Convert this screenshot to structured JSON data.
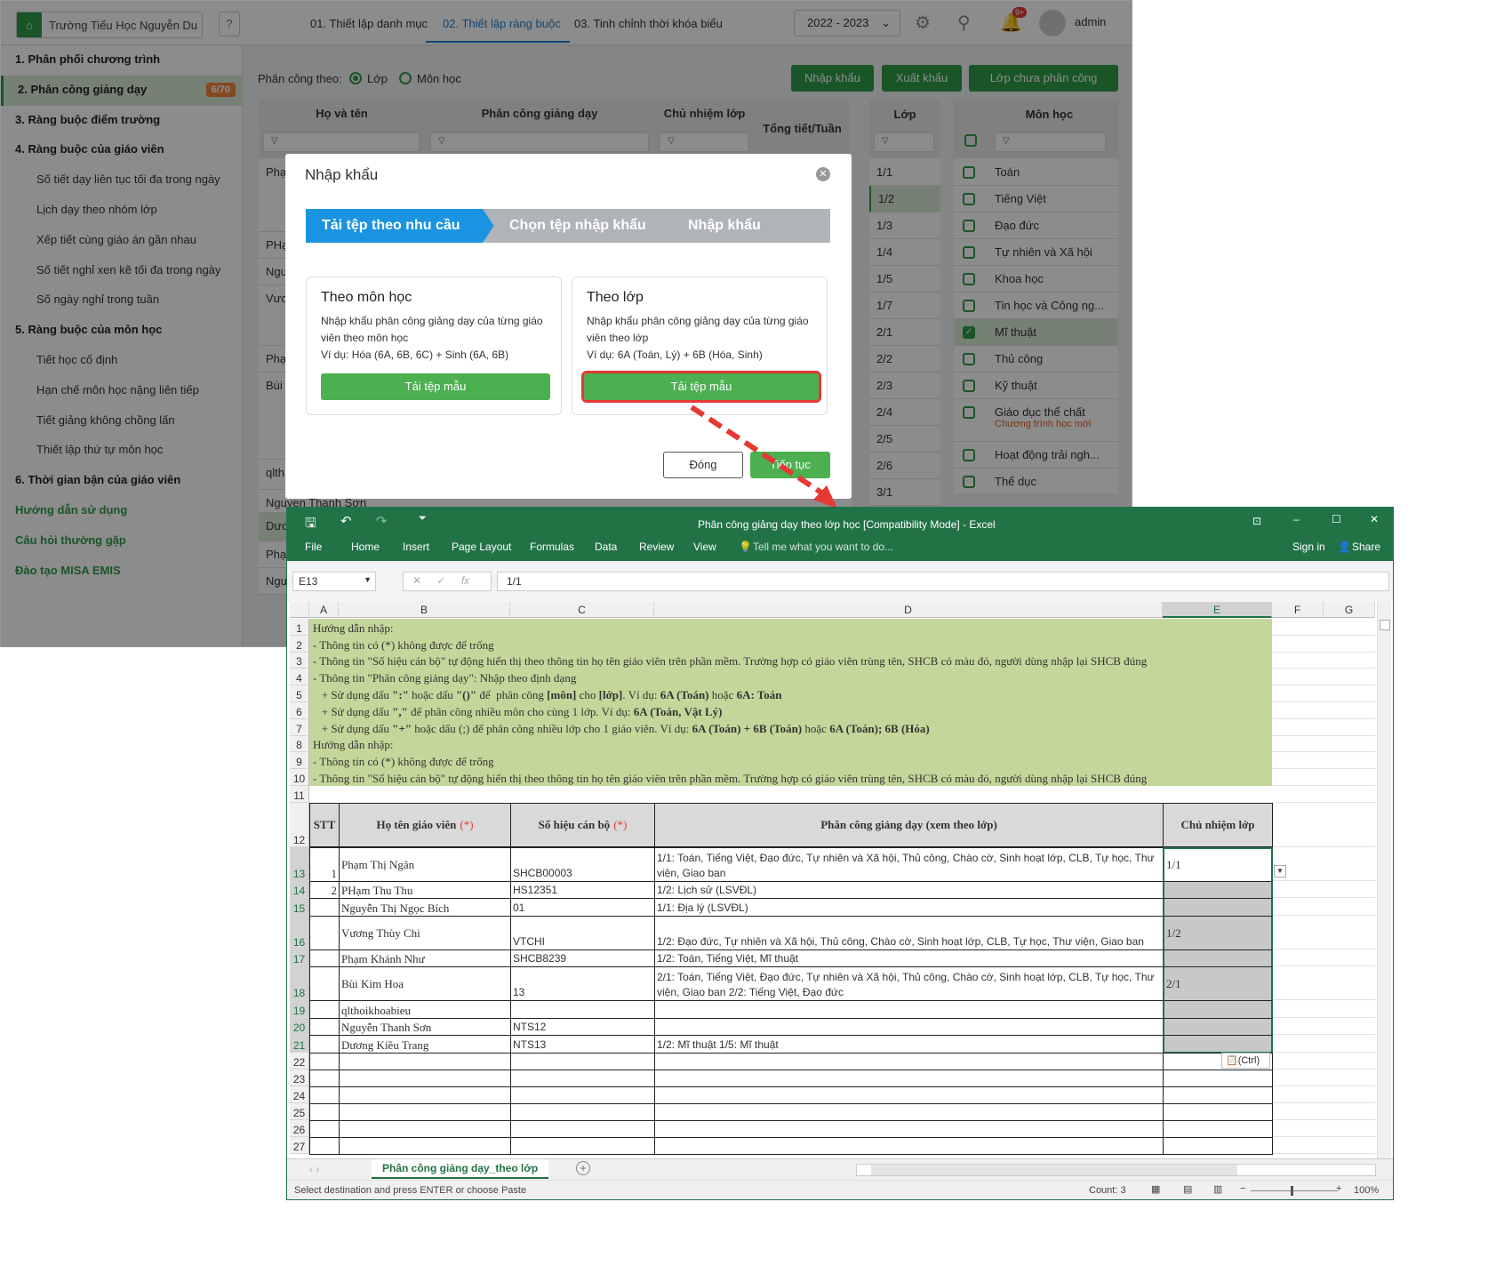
{
  "app": {
    "school": "Trường Tiểu Học Nguyễn Du",
    "nav_tabs": [
      "01. Thiết lập danh mục",
      "02. Thiết lập ràng buộc",
      "03. Tinh chỉnh thời khóa biểu"
    ],
    "year": "2022 - 2023",
    "notif_badge": "9+",
    "user": "admin",
    "sidebar": [
      {
        "label": "1. Phân phối chương trình",
        "type": "b"
      },
      {
        "label": "2. Phân công giảng dạy",
        "type": "b",
        "badge": "6/70"
      },
      {
        "label": "3. Ràng buộc điểm trường",
        "type": "b"
      },
      {
        "label": "4. Ràng buộc của giáo viên",
        "type": "b"
      },
      {
        "label": "Số tiết dạy liên tục tối đa trong ngày",
        "type": "sub"
      },
      {
        "label": "Lịch dạy theo nhóm lớp",
        "type": "sub"
      },
      {
        "label": "Xếp tiết cùng giáo án gần nhau",
        "type": "sub"
      },
      {
        "label": "Số tiết nghỉ xen kẽ tối đa trong ngày",
        "type": "sub"
      },
      {
        "label": "Số ngày nghỉ trong tuần",
        "type": "sub"
      },
      {
        "label": "5. Ràng buộc của môn học",
        "type": "b"
      },
      {
        "label": "Tiết học cố định",
        "type": "sub"
      },
      {
        "label": "Hạn chế môn học nặng liên tiếp",
        "type": "sub"
      },
      {
        "label": "Tiết giảng không chồng lấn",
        "type": "sub"
      },
      {
        "label": "Thiết lập thứ tự môn học",
        "type": "sub"
      },
      {
        "label": "6. Thời gian bận của giáo viên",
        "type": "b"
      },
      {
        "label": "Hướng dẫn sử dụng",
        "type": "g"
      },
      {
        "label": "Câu hỏi thường gặp",
        "type": "g"
      },
      {
        "label": "Đào tạo MISA EMIS",
        "type": "g"
      }
    ],
    "assign_by_label": "Phân công theo:",
    "assign_by_options": [
      "Lớp",
      "Môn học"
    ],
    "buttons": {
      "import": "Nhập khẩu",
      "export": "Xuất khẩu",
      "unassigned": "Lớp chưa phân công"
    },
    "table_headers": {
      "name": "Họ và tên",
      "assign": "Phân công giảng dạy",
      "homeroom": "Chủ nhiệm lớp",
      "total": "Tổng tiết/Tuần",
      "class": "Lớp",
      "subject": "Môn học"
    },
    "teacher_rows_visible": [
      "Phạ",
      "PHạ",
      "Ngu",
      "Vươ",
      "Phạ",
      "Bùi",
      "qlth",
      "Nguyen Thanh Sơn",
      "Dươ",
      "Phạ",
      "Ngu"
    ],
    "classes": [
      "1/1",
      "1/2",
      "1/3",
      "1/4",
      "1/5",
      "1/7",
      "2/1",
      "2/2",
      "2/3",
      "2/4",
      "2/5",
      "2/6",
      "3/1"
    ],
    "subjects": [
      {
        "name": "Toán",
        "checked": false
      },
      {
        "name": "Tiếng Việt",
        "checked": false
      },
      {
        "name": "Đạo đức",
        "checked": false
      },
      {
        "name": "Tự nhiên và Xã hội",
        "checked": false
      },
      {
        "name": "Khoa học",
        "checked": false
      },
      {
        "name": "Tin học và Công ng...",
        "checked": false
      },
      {
        "name": "Mĩ thuật",
        "checked": true
      },
      {
        "name": "Thủ công",
        "checked": false
      },
      {
        "name": "Kỹ thuật",
        "checked": false
      },
      {
        "name": "Giáo dục thể chất",
        "checked": false,
        "note": "Chương trình học mới"
      },
      {
        "name": "Hoạt động trải ngh...",
        "checked": false
      },
      {
        "name": "Thể dục",
        "checked": false
      }
    ]
  },
  "modal": {
    "title": "Nhập khẩu",
    "steps": [
      "Tải tệp theo nhu cầu",
      "Chọn tệp nhập khẩu",
      "Nhập khẩu"
    ],
    "cards": [
      {
        "title": "Theo môn học",
        "desc": "Nhập khẩu phân công giảng dạy của từng giáo viên theo môn học",
        "example": "Ví dụ: Hóa (6A, 6B, 6C) + Sinh (6A, 6B)",
        "button": "Tải tệp mẫu"
      },
      {
        "title": "Theo lớp",
        "desc": "Nhập khẩu phân công giảng dạy của từng giáo viên theo lớp",
        "example": "Ví dụ: 6A (Toán, Lý) + 6B (Hóa, Sinh)",
        "button": "Tải tệp mẫu"
      }
    ],
    "close_label": "Đóng",
    "continue_label": "Tiếp tục",
    "highlight_color": "#e53935"
  },
  "excel": {
    "title": "Phân công giảng dạy theo lớp học  [Compatibility Mode] - Excel",
    "ribbon_tabs": [
      "File",
      "Home",
      "Insert",
      "Page Layout",
      "Formulas",
      "Data",
      "Review",
      "View"
    ],
    "tell_me": "Tell me what you want to do...",
    "sign_in": "Sign in",
    "share": "Share",
    "name_box": "E13",
    "formula": "1/1",
    "columns": [
      "A",
      "B",
      "C",
      "D",
      "E",
      "F",
      "G"
    ],
    "guide_rows": [
      [
        {
          "t": "Hướng dẫn nhập:"
        }
      ],
      [
        {
          "t": "- Thông tin có (*) không được để trống"
        }
      ],
      [
        {
          "t": "- Thông tin \"Số hiệu cán bộ\" tự động hiển thị theo thông tin họ tên giáo viên trên phần mềm. Trường hợp có giáo viên trùng tên, SHCB có màu đỏ, người dùng nhập lại SHCB đúng"
        }
      ],
      [
        {
          "t": "- Thông tin \"Phân công giảng dạy\": Nhập theo định dạng"
        }
      ],
      [
        {
          "t": "   + Sử dụng dấu "
        },
        {
          "t": "\":\"",
          "b": true
        },
        {
          "t": " hoặc dấu "
        },
        {
          "t": "\"()\"",
          "b": true
        },
        {
          "t": " để  phân công "
        },
        {
          "t": "[môn]",
          "b": true
        },
        {
          "t": " cho "
        },
        {
          "t": "[lớp]",
          "b": true
        },
        {
          "t": ". Ví dụ: "
        },
        {
          "t": "6A (Toán)",
          "b": true
        },
        {
          "t": " hoặc "
        },
        {
          "t": "6A: Toán",
          "b": true
        }
      ],
      [
        {
          "t": "   + Sử dụng dấu "
        },
        {
          "t": "\",\"",
          "b": true
        },
        {
          "t": " để phân công nhiều môn cho cùng 1 lớp. Ví dụ: "
        },
        {
          "t": "6A (Toán, Vật Lý)",
          "b": true
        }
      ],
      [
        {
          "t": "   + Sử dụng dấu "
        },
        {
          "t": "\"+\"",
          "b": true
        },
        {
          "t": " hoặc dấu (;) để phân công nhiều lớp cho 1 giáo viên. Ví dụ: "
        },
        {
          "t": "6A (Toán) + 6B (Toán)",
          "b": true
        },
        {
          "t": " hoặc "
        },
        {
          "t": "6A (Toán); 6B (Hóa)",
          "b": true
        }
      ],
      [
        {
          "t": "Hướng dẫn nhập:"
        }
      ],
      [
        {
          "t": "- Thông tin có (*) không được để trống"
        }
      ],
      [
        {
          "t": "- Thông tin \"Số hiệu cán bộ\" tự động hiển thị theo thông tin họ tên giáo viên trên phần mềm. Trường hợp có giáo viên trùng tên, SHCB có màu đỏ, người dùng nhập lại SHCB đúng"
        }
      ]
    ],
    "table_header": {
      "stt": "STT",
      "name": "Họ tên giáo viên",
      "code": "Số hiệu cán bộ",
      "assign": "Phân công giảng dạy (xem theo lớp)",
      "homeroom": "Chủ nhiệm lớp",
      "required": "(*)"
    },
    "rows": [
      {
        "row": "13",
        "stt": "1",
        "name": "Phạm Thị Ngân",
        "code": "SHCB00003",
        "assign": "1/1: Toán, Tiếng Việt, Đạo đức, Tự nhiên và Xã hội, Thủ công, Chào cờ, Sinh hoạt lớp, CLB, Tự học, Thư viện, Giao ban",
        "homeroom": "1/1",
        "tall": true
      },
      {
        "row": "14",
        "stt": "2",
        "name": "PHạm Thu Thu",
        "code": "HS12351",
        "assign": "1/2: Lịch sử (LSVĐL)",
        "homeroom": ""
      },
      {
        "row": "15",
        "stt": "",
        "name": "Nguyễn Thị Ngọc Bích",
        "code": "01",
        "assign": "1/1: Địa lý (LSVĐL)",
        "homeroom": ""
      },
      {
        "row": "16",
        "stt": "",
        "name": "Vương Thùy Chi",
        "code": "VTCHI",
        "assign": "1/2: Đạo đức, Tự nhiên và Xã hội, Thủ công, Chào cờ, Sinh hoạt lớp, CLB, Tự học, Thư viện, Giao ban",
        "homeroom": "1/2",
        "tall": true
      },
      {
        "row": "17",
        "stt": "",
        "name": "Phạm Khánh Như",
        "code": "SHCB8239",
        "assign": "1/2: Toán, Tiếng Việt, Mĩ thuật",
        "homeroom": ""
      },
      {
        "row": "18",
        "stt": "",
        "name": "Bùi Kim Hoa",
        "code": "13",
        "assign": "2/1: Toán, Tiếng Việt, Đạo đức, Tự nhiên và Xã hội, Thủ công, Chào cờ, Sinh hoạt lớp, CLB, Tự học, Thư viện, Giao ban    2/2: Tiếng Việt, Đạo đức",
        "homeroom": "2/1",
        "tall": true
      },
      {
        "row": "19",
        "stt": "",
        "name": "qlthoikhoabieu",
        "code": "",
        "assign": "",
        "homeroom": ""
      },
      {
        "row": "20",
        "stt": "",
        "name": "Nguyễn Thanh Sơn",
        "code": "NTS12",
        "assign": "",
        "homeroom": ""
      },
      {
        "row": "21",
        "stt": "",
        "name": "Dương Kiều Trang",
        "code": "NTS13",
        "assign": "1/2: Mĩ thuật    1/5: Mĩ thuật",
        "homeroom": ""
      }
    ],
    "empty_rows": [
      "22",
      "23",
      "24",
      "25",
      "26",
      "27"
    ],
    "paste_tag": "(Ctrl)",
    "sheet_tab": "Phân công giảng dạy_theo lớp",
    "status_text": "Select destination and press ENTER or choose Paste",
    "count": "Count: 3",
    "zoom": "100%"
  }
}
